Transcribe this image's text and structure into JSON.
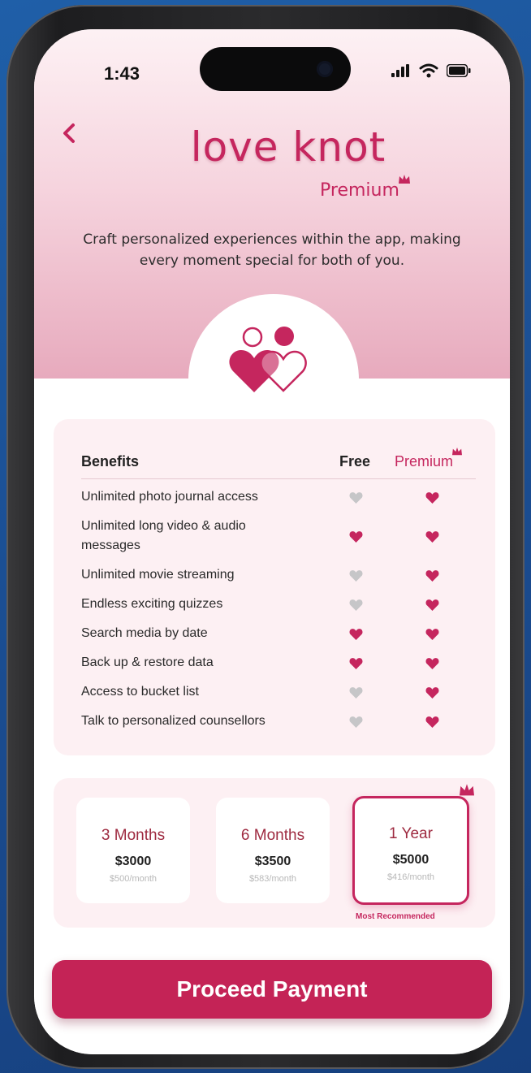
{
  "status_bar": {
    "time": "1:43"
  },
  "header": {
    "app_title": "love knot",
    "badge": "Premium",
    "tagline": "Craft personalized experiences within the app, making every moment special for both of you."
  },
  "benefits": {
    "headers": {
      "benefit": "Benefits",
      "free": "Free",
      "premium": "Premium"
    },
    "rows": [
      {
        "label": "Unlimited photo journal access",
        "free": false,
        "premium": true
      },
      {
        "label": "Unlimited long video & audio messages",
        "free": true,
        "premium": true
      },
      {
        "label": "Unlimited movie streaming",
        "free": false,
        "premium": true
      },
      {
        "label": "Endless exciting quizzes",
        "free": false,
        "premium": true
      },
      {
        "label": "Search media by date",
        "free": true,
        "premium": true
      },
      {
        "label": "Back up & restore data",
        "free": true,
        "premium": true
      },
      {
        "label": "Access to bucket list",
        "free": false,
        "premium": true
      },
      {
        "label": "Talk to personalized counsellors",
        "free": false,
        "premium": true
      }
    ]
  },
  "plans": {
    "items": [
      {
        "name": "3 Months",
        "price": "$3000",
        "monthly": "$500/month",
        "selected": false
      },
      {
        "name": "6 Months",
        "price": "$3500",
        "monthly": "$583/month",
        "selected": false
      },
      {
        "name": "1 Year",
        "price": "$5000",
        "monthly": "$416/month",
        "selected": true
      }
    ],
    "recommended_label": "Most Recommended"
  },
  "cta": {
    "label": "Proceed Payment"
  },
  "colors": {
    "accent": "#c5265e",
    "heart_on": "#c5265e",
    "heart_off": "#c6c6c8",
    "card_bg": "#fdf0f3"
  },
  "icons": {
    "back": "chevron-left-icon",
    "crown": "crown-icon",
    "hero": "couple-hearts-icon",
    "signal": "signal-icon",
    "wifi": "wifi-icon",
    "battery": "battery-icon",
    "heart": "heart-icon"
  }
}
